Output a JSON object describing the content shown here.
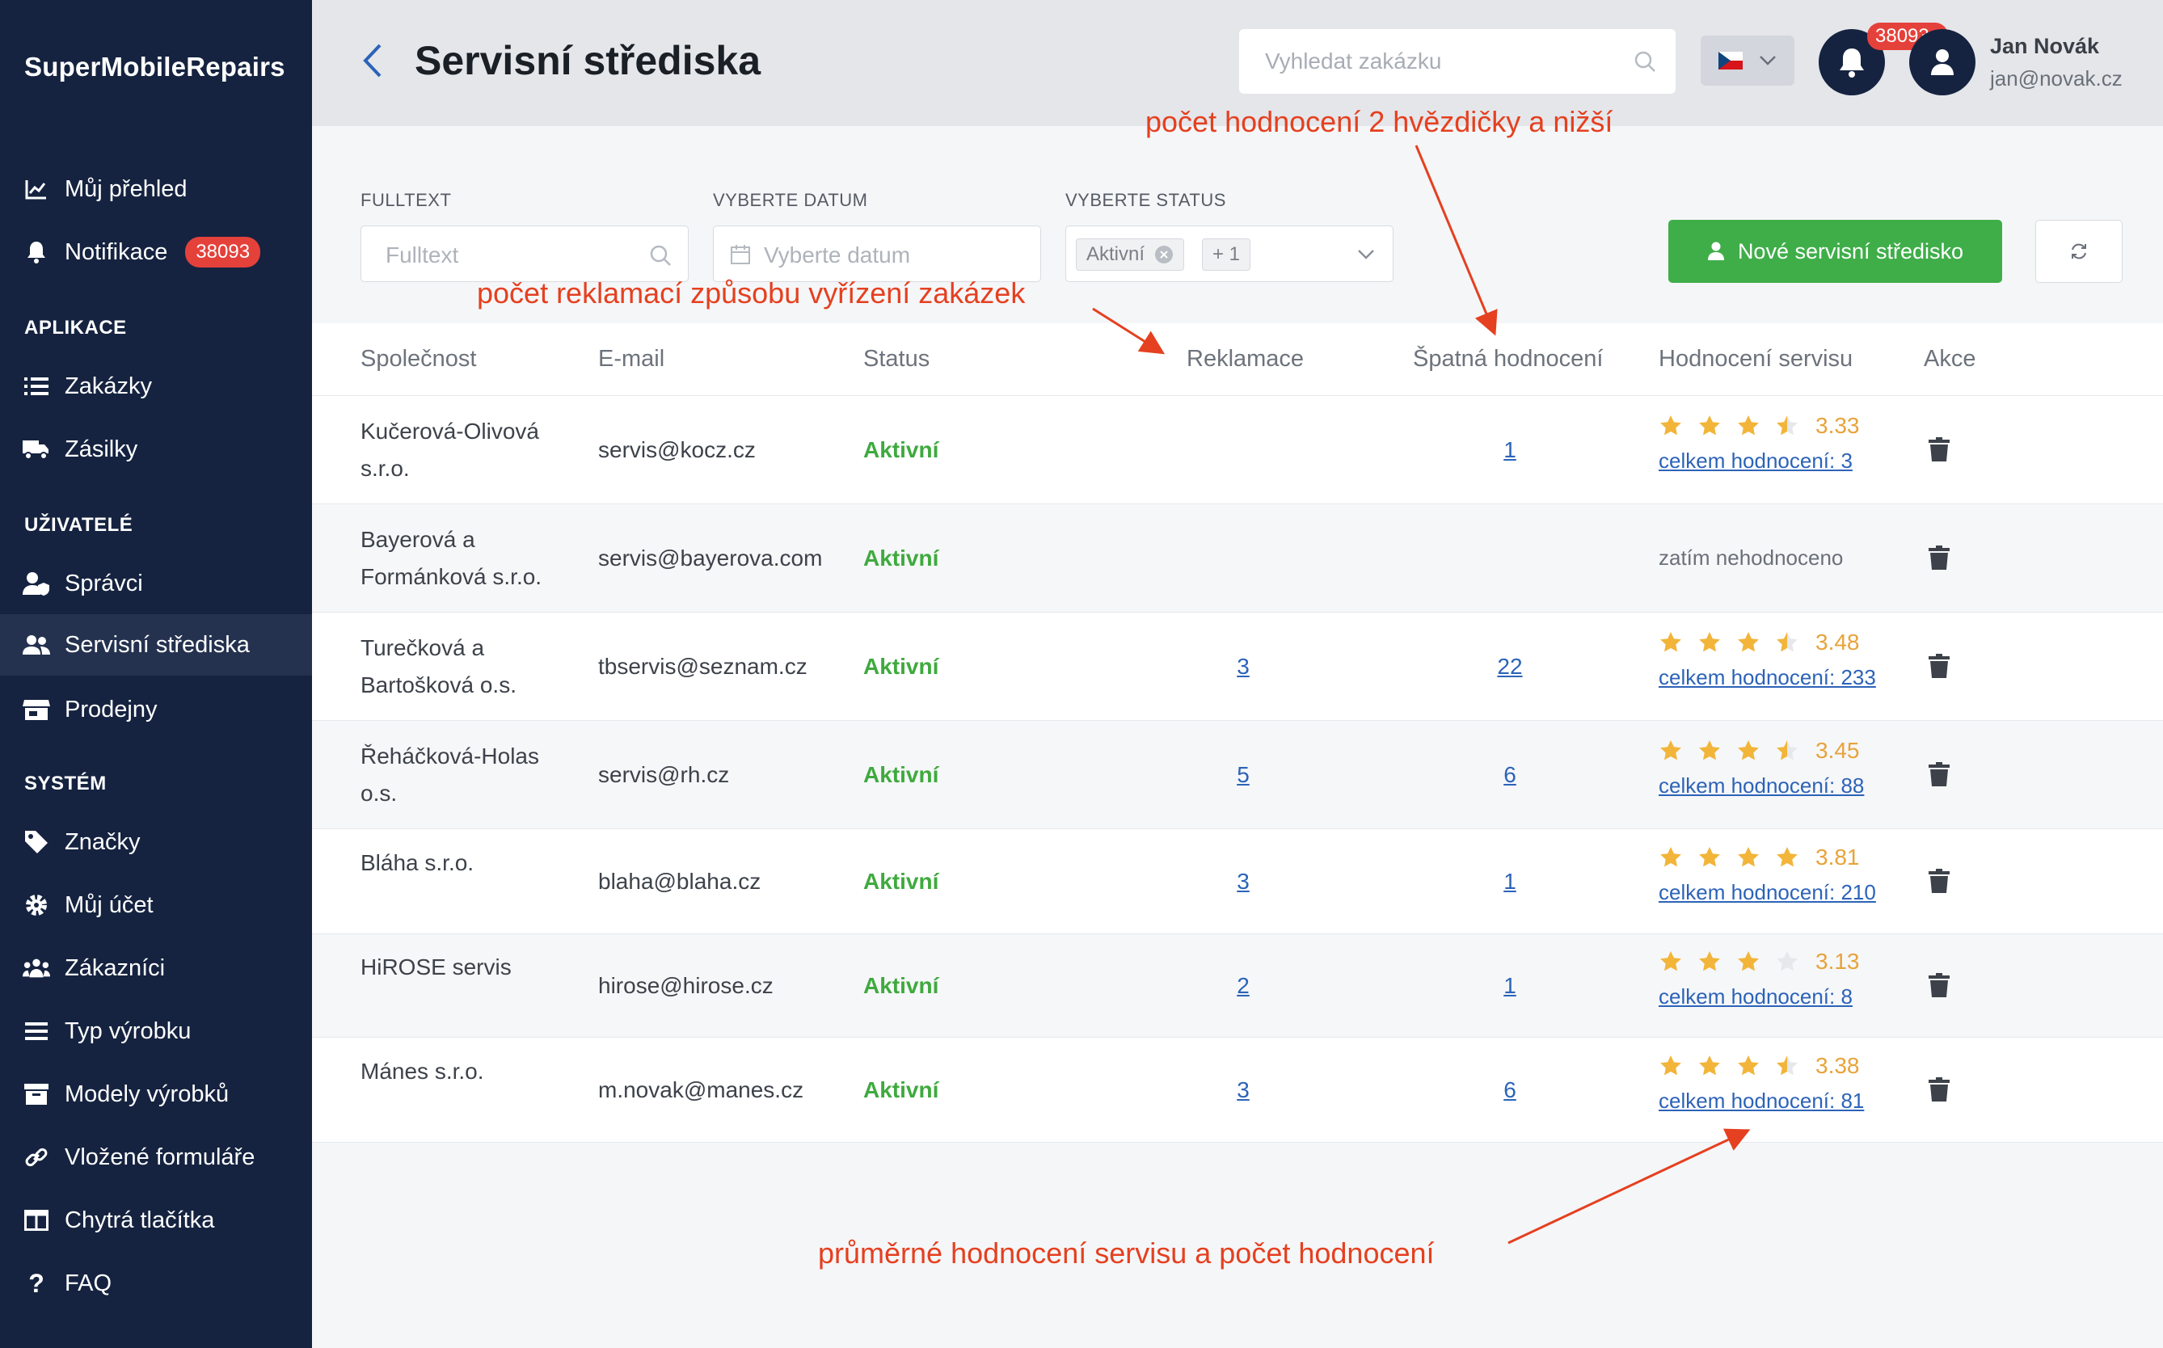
{
  "app": {
    "name": "SuperMobileRepairs"
  },
  "sidebar": {
    "items_top": [
      {
        "label": "Můj přehled",
        "icon": "chart-line-icon"
      },
      {
        "label": "Notifikace",
        "icon": "bell-icon",
        "badge": "38093"
      }
    ],
    "sections": [
      {
        "title": "APLIKACE",
        "items": [
          {
            "label": "Zakázky",
            "icon": "list-icon"
          },
          {
            "label": "Zásilky",
            "icon": "truck-icon"
          }
        ]
      },
      {
        "title": "UŽIVATELÉ",
        "items": [
          {
            "label": "Správci",
            "icon": "user-shield-icon"
          },
          {
            "label": "Servisní střediska",
            "icon": "users-icon",
            "active": true
          },
          {
            "label": "Prodejny",
            "icon": "store-icon"
          }
        ]
      },
      {
        "title": "SYSTÉM",
        "items": [
          {
            "label": "Značky",
            "icon": "tag-icon"
          },
          {
            "label": "Můj účet",
            "icon": "gear-icon"
          },
          {
            "label": "Zákazníci",
            "icon": "users-group-icon"
          },
          {
            "label": "Typ výrobku",
            "icon": "bars-icon"
          },
          {
            "label": "Modely výrobků",
            "icon": "archive-icon"
          },
          {
            "label": "Vložené formuláře",
            "icon": "link-icon"
          },
          {
            "label": "Chytrá tlačítka",
            "icon": "columns-icon"
          },
          {
            "label": "FAQ",
            "icon": "question-icon"
          }
        ]
      }
    ]
  },
  "header": {
    "title": "Servisní střediska",
    "search_placeholder": "Vyhledat zakázku",
    "notif_badge": "38093",
    "user_name": "Jan Novák",
    "user_email": "jan@novak.cz"
  },
  "filters": {
    "fulltext_label": "FULLTEXT",
    "fulltext_placeholder": "Fulltext",
    "date_label": "VYBERTE DATUM",
    "date_placeholder": "Vyberte datum",
    "status_label": "VYBERTE STATUS",
    "status_chip": "Aktivní",
    "status_more": "+ 1",
    "new_button": "Nové servisní středisko"
  },
  "table": {
    "columns": [
      "Společnost",
      "E-mail",
      "Status",
      "Reklamace",
      "Špatná hodnocení",
      "Hodnocení servisu",
      "Akce"
    ],
    "rows": [
      {
        "company": "Kučerová-Olivová s.r.o.",
        "email": "servis@kocz.cz",
        "status": "Aktivní",
        "claims": "",
        "bad": "1",
        "rating": "3.33",
        "stars": 3.33,
        "total": "celkem hodnocení: 3"
      },
      {
        "company": "Bayerová a Formánková s.r.o.",
        "email": "servis@bayerova.com",
        "status": "Aktivní",
        "claims": "",
        "bad": "",
        "rating": "",
        "stars": 0,
        "total": "",
        "unrated": "zatím nehodnoceno"
      },
      {
        "company": "Turečková a Bartošková o.s.",
        "email": "tbservis@seznam.cz",
        "status": "Aktivní",
        "claims": "3",
        "bad": "22",
        "rating": "3.48",
        "stars": 3.48,
        "total": "celkem hodnocení: 233"
      },
      {
        "company": "Řeháčková-Holas o.s.",
        "email": "servis@rh.cz",
        "status": "Aktivní",
        "claims": "5",
        "bad": "6",
        "rating": "3.45",
        "stars": 3.45,
        "total": "celkem hodnocení: 88"
      },
      {
        "company": "Bláha s.r.o.",
        "email": "blaha@blaha.cz",
        "status": "Aktivní",
        "claims": "3",
        "bad": "1",
        "rating": "3.81",
        "stars": 3.81,
        "total": "celkem hodnocení: 210"
      },
      {
        "company": "HiROSE servis",
        "email": "hirose@hirose.cz",
        "status": "Aktivní",
        "claims": "2",
        "bad": "1",
        "rating": "3.13",
        "stars": 3.13,
        "total": "celkem hodnocení: 8"
      },
      {
        "company": "Mánes s.r.o.",
        "email": "m.novak@manes.cz",
        "status": "Aktivní",
        "claims": "3",
        "bad": "6",
        "rating": "3.38",
        "stars": 3.38,
        "total": "celkem hodnocení: 81"
      }
    ]
  },
  "annotations": {
    "bad_ratings": "počet hodnocení 2 hvězdičky a nižší",
    "claims": "počet reklamací způsobu vyřízení zakázek",
    "rating": "průměrné hodnocení servisu a počet hodnocení"
  },
  "colors": {
    "sidebar": "#152340",
    "accent_green": "#3fae49",
    "status_green": "#3faa3e",
    "link": "#2c63b8",
    "star": "#f2b53a",
    "annotation": "#e5401f",
    "badge": "#e5413b"
  }
}
